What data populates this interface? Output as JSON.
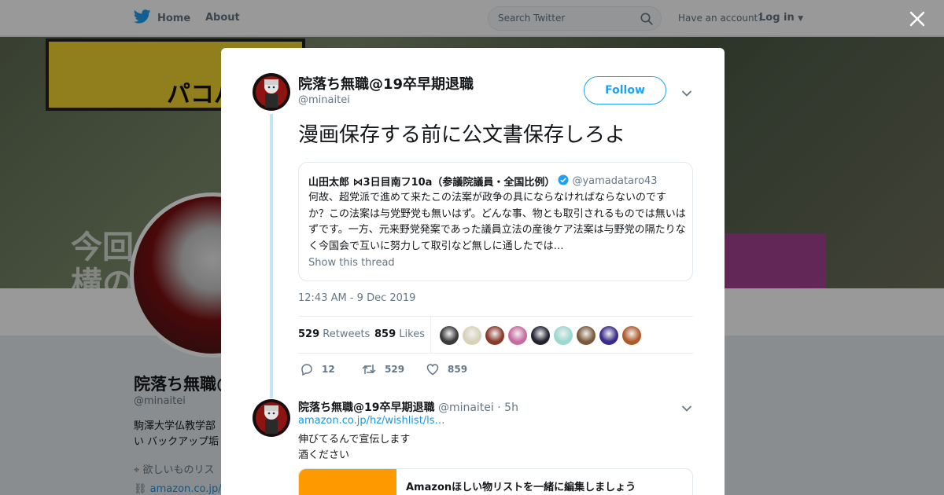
{
  "nav": {
    "home_label": "Home",
    "about_label": "About",
    "search_placeholder": "Search Twitter",
    "have_account": "Have an account?",
    "login_label": "Log in"
  },
  "background_profile": {
    "name": "院落ち無職@",
    "handle": "@minaitei",
    "bio_line1": "駒澤大学仏教学部",
    "bio_line2": "い バックアップ垢",
    "location": "欲しいものリス",
    "url": "amazon.co.jp/",
    "banner_sign": "パコパコ女",
    "banner_big_line1": "今回",
    "banner_big_line2": "構の"
  },
  "tweet": {
    "author_name": "院落ち無職@19卒早期退職",
    "author_handle": "@minaitei",
    "follow_label": "Follow",
    "text": "漫画保存する前に公文書保存しろよ",
    "timestamp": "12:43 AM - 9 Dec 2019",
    "retweets_count": "529",
    "retweets_label": "Retweets",
    "likes_count": "859",
    "likes_label": "Likes",
    "actions": {
      "reply_count": "12",
      "retweet_count": "529",
      "like_count": "859"
    },
    "likers_colors": [
      "#3a3a3a",
      "#d8d2b8",
      "#8a3a2a",
      "#c86aa0",
      "#222233",
      "#9ad8d0",
      "#7a5a3a",
      "#3a2a8a",
      "#b05a2a"
    ]
  },
  "quote": {
    "name": "山田太郎 ⋈3日目南フ10a（参議院議員・全国比例）",
    "handle": "@yamadataro43",
    "body": "何故、超党派で進めて来たこの法案が政争の具にならなければならないのですか？この法案は与党野党も無いはず。どんな事、物とも取引されるものでは無いはずです。一方、元来野党発案であった議員立法の産後ケア法案は与野党の隔たりなく今国会で互いに努力して取引など無しに通したでは…",
    "show_thread": "Show this thread"
  },
  "reply": {
    "author_name": "院落ち無職@19卒早期退職",
    "author_handle": "@minaitei",
    "time": "· 5h",
    "link": "amazon.co.jp/hz/wishlist/ls…",
    "line1": "伸びてるんで宣伝します",
    "line2": "酒ください",
    "card_title": "Amazonほしい物リストを一緒に編集しましょう"
  },
  "colors": {
    "accent": "#1da1f2",
    "link": "#1b95e0",
    "muted": "#657786"
  }
}
